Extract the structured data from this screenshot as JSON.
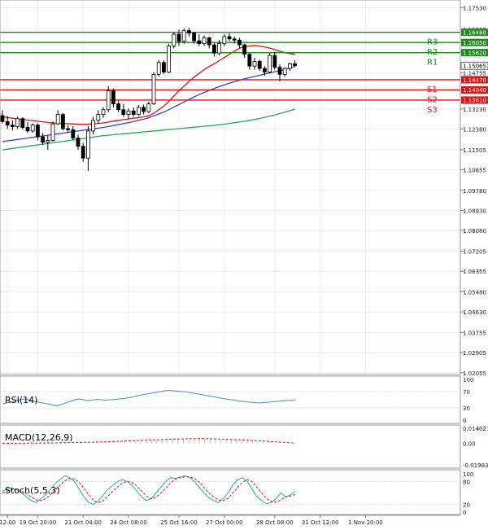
{
  "chart_data": [
    {
      "type": "candlestick",
      "price_ticks": [
        "1.17530",
        "1.16605",
        "1.15680",
        "1.14755",
        "1.13230",
        "1.12380",
        "1.11505",
        "1.10655",
        "1.09780",
        "1.08930",
        "1.08080",
        "1.07205",
        "1.06355",
        "1.05480",
        "1.04630",
        "1.03755",
        "1.02905",
        "1.02055"
      ],
      "ylim": [
        1.0198,
        1.1785
      ],
      "current_price": "1.15065",
      "candles": [
        [
          1.1295,
          1.1318,
          1.1262,
          1.127
        ],
        [
          1.127,
          1.1292,
          1.124,
          1.1255
        ],
        [
          1.1255,
          1.1275,
          1.1232,
          1.1248
        ],
        [
          1.1248,
          1.129,
          1.124,
          1.1282
        ],
        [
          1.1282,
          1.1288,
          1.1236,
          1.1245
        ],
        [
          1.1245,
          1.1268,
          1.1222,
          1.123
        ],
        [
          1.123,
          1.1262,
          1.1222,
          1.1255
        ],
        [
          1.1255,
          1.1262,
          1.119,
          1.1205
        ],
        [
          1.1205,
          1.1222,
          1.1172,
          1.1182
        ],
        [
          1.1182,
          1.121,
          1.115,
          1.119
        ],
        [
          1.119,
          1.127,
          1.1185,
          1.126
        ],
        [
          1.126,
          1.1318,
          1.1255,
          1.13
        ],
        [
          1.13,
          1.1305,
          1.1232,
          1.124
        ],
        [
          1.124,
          1.1255,
          1.1222,
          1.1235
        ],
        [
          1.1235,
          1.125,
          1.119,
          1.12
        ],
        [
          1.12,
          1.1215,
          1.115,
          1.1165
        ],
        [
          1.1165,
          1.118,
          1.11,
          1.1115
        ],
        [
          1.1115,
          1.125,
          1.106,
          1.123
        ],
        [
          1.123,
          1.129,
          1.1215,
          1.1275
        ],
        [
          1.1275,
          1.1318,
          1.1262,
          1.13
        ],
        [
          1.13,
          1.133,
          1.1285,
          1.132
        ],
        [
          1.132,
          1.142,
          1.131,
          1.14
        ],
        [
          1.14,
          1.141,
          1.133,
          1.1345
        ],
        [
          1.1345,
          1.136,
          1.131,
          1.132
        ],
        [
          1.132,
          1.1345,
          1.129,
          1.13
        ],
        [
          1.13,
          1.1325,
          1.1282,
          1.1315
        ],
        [
          1.1315,
          1.133,
          1.129,
          1.13
        ],
        [
          1.13,
          1.134,
          1.1295,
          1.133
        ],
        [
          1.133,
          1.1342,
          1.13,
          1.1312
        ],
        [
          1.1312,
          1.1355,
          1.1305,
          1.1345
        ],
        [
          1.1345,
          1.148,
          1.134,
          1.147
        ],
        [
          1.147,
          1.153,
          1.146,
          1.152
        ],
        [
          1.152,
          1.153,
          1.147,
          1.148
        ],
        [
          1.148,
          1.16,
          1.1475,
          1.159
        ],
        [
          1.159,
          1.165,
          1.158,
          1.164
        ],
        [
          1.164,
          1.166,
          1.159,
          1.161
        ],
        [
          1.161,
          1.1665,
          1.16,
          1.1655
        ],
        [
          1.1655,
          1.1668,
          1.163,
          1.1645
        ],
        [
          1.1645,
          1.165,
          1.16,
          1.1612
        ],
        [
          1.1612,
          1.164,
          1.159,
          1.16
        ],
        [
          1.16,
          1.1635,
          1.159,
          1.1625
        ],
        [
          1.1625,
          1.163,
          1.158,
          1.1595
        ],
        [
          1.1595,
          1.1605,
          1.1545,
          1.156
        ],
        [
          1.156,
          1.1615,
          1.155,
          1.16
        ],
        [
          1.16,
          1.164,
          1.159,
          1.163
        ],
        [
          1.163,
          1.1645,
          1.161,
          1.162
        ],
        [
          1.162,
          1.163,
          1.16,
          1.1615
        ],
        [
          1.1615,
          1.1625,
          1.158,
          1.1595
        ],
        [
          1.1595,
          1.16,
          1.154,
          1.1555
        ],
        [
          1.1555,
          1.156,
          1.149,
          1.1505
        ],
        [
          1.1505,
          1.154,
          1.149,
          1.1525
        ],
        [
          1.1525,
          1.1532,
          1.1485,
          1.1495
        ],
        [
          1.1495,
          1.1505,
          1.1465,
          1.148
        ],
        [
          1.148,
          1.156,
          1.1475,
          1.155
        ],
        [
          1.155,
          1.1565,
          1.149,
          1.15
        ],
        [
          1.15,
          1.1512,
          1.144,
          1.147
        ],
        [
          1.147,
          1.15,
          1.146,
          1.1495
        ],
        [
          1.1495,
          1.152,
          1.1485,
          1.1515
        ],
        [
          1.1515,
          1.153,
          1.15,
          1.1507
        ]
      ],
      "moving_averages": [
        {
          "color": "#dd1111",
          "values": [
            1.129,
            1.1287,
            1.1284,
            1.1281,
            1.1279,
            1.1276,
            1.1274,
            1.1271,
            1.1269,
            1.1266,
            1.1264,
            1.1263,
            1.1262,
            1.1261,
            1.126,
            1.1259,
            1.1258,
            1.1259,
            1.126,
            1.1262,
            1.1264,
            1.1268,
            1.1272,
            1.1275,
            1.1278,
            1.1281,
            1.1284,
            1.1287,
            1.129,
            1.1294,
            1.1305,
            1.132,
            1.1335,
            1.1355,
            1.1378,
            1.14,
            1.142,
            1.144,
            1.1458,
            1.1474,
            1.149,
            1.1503,
            1.1515,
            1.1528,
            1.1541,
            1.1555,
            1.1568,
            1.158,
            1.1587,
            1.159,
            1.1592,
            1.159,
            1.1586,
            1.1581,
            1.1575,
            1.1568,
            1.1562,
            1.1558,
            1.1555
          ]
        },
        {
          "color": "#3344cc",
          "values": [
            1.1185,
            1.1188,
            1.1191,
            1.1194,
            1.1197,
            1.12,
            1.1203,
            1.1206,
            1.1209,
            1.1212,
            1.1215,
            1.1218,
            1.1221,
            1.1224,
            1.1227,
            1.123,
            1.1233,
            1.1236,
            1.1239,
            1.1242,
            1.1245,
            1.1249,
            1.1253,
            1.1257,
            1.1261,
            1.1265,
            1.127,
            1.1275,
            1.128,
            1.1286,
            1.1294,
            1.1302,
            1.131,
            1.132,
            1.1331,
            1.1342,
            1.1353,
            1.1364,
            1.1374,
            1.1384,
            1.1393,
            1.1402,
            1.141,
            1.1418,
            1.1425,
            1.1432,
            1.1439,
            1.1445,
            1.1451,
            1.1456,
            1.1461,
            1.1466,
            1.1471,
            1.1476,
            1.1481,
            1.1486,
            1.1491,
            1.1497,
            1.1503
          ]
        },
        {
          "color": "#22aa55",
          "values": [
            1.115,
            1.1153,
            1.1156,
            1.1159,
            1.1162,
            1.1165,
            1.1168,
            1.1171,
            1.1174,
            1.1177,
            1.118,
            1.1183,
            1.1186,
            1.1189,
            1.1192,
            1.1195,
            1.1198,
            1.1201,
            1.1204,
            1.1207,
            1.121,
            1.1212,
            1.1214,
            1.1216,
            1.1218,
            1.122,
            1.1222,
            1.1224,
            1.1226,
            1.1228,
            1.123,
            1.1232,
            1.1234,
            1.1236,
            1.1238,
            1.124,
            1.1242,
            1.1244,
            1.1246,
            1.1248,
            1.125,
            1.1252,
            1.1254,
            1.1256,
            1.1259,
            1.1262,
            1.1265,
            1.1268,
            1.1271,
            1.1275,
            1.1279,
            1.1283,
            1.1288,
            1.1293,
            1.1298,
            1.1304,
            1.131,
            1.1316,
            1.1322
          ]
        }
      ],
      "levels": [
        {
          "label": "R3",
          "value": 1.1648,
          "text": "1.16480",
          "color": "#1e8a1e"
        },
        {
          "label": "R2",
          "value": 1.1605,
          "text": "1.16050",
          "color": "#1e8a1e"
        },
        {
          "label": "R1",
          "value": 1.1562,
          "text": "1.15620",
          "color": "#1e8a1e"
        },
        {
          "label": "S1",
          "value": 1.1447,
          "text": "1.14470",
          "color": "#e01010"
        },
        {
          "label": "S2",
          "value": 1.1404,
          "text": "1.14040",
          "color": "#e01010"
        },
        {
          "label": "S3",
          "value": 1.1361,
          "text": "1.13610",
          "color": "#e01010"
        }
      ]
    },
    {
      "type": "line",
      "name": "RSI(14)",
      "ticks": [
        "100",
        "70",
        "30",
        "0"
      ],
      "ylim": [
        0,
        100
      ],
      "values": [
        40,
        42,
        45,
        48,
        50,
        52,
        49,
        46,
        44,
        42,
        40,
        38,
        35,
        38,
        42,
        46,
        50,
        52,
        50,
        48,
        49,
        51,
        50,
        49,
        50,
        51,
        52,
        53,
        55,
        57,
        60,
        62,
        64,
        66,
        68,
        70,
        72,
        73,
        72,
        71,
        70,
        69,
        67,
        65,
        63,
        61,
        59,
        57,
        55,
        53,
        51,
        50,
        48,
        46,
        45,
        44,
        43,
        42,
        43,
        44,
        45,
        46,
        47,
        48,
        49,
        50
      ]
    },
    {
      "type": "histogram",
      "name": "MACD(12,26,9)",
      "ticks": [
        "0.014021",
        "0.00",
        "-0.019835"
      ],
      "ylim": [
        -0.019835,
        0.014021
      ],
      "bars": [
        0.0001,
        0.0001,
        0.0002,
        0.0002,
        0.0003,
        0.0003,
        0.0004,
        0.0004,
        0.0005,
        0.0005,
        0.0006,
        0.0007,
        0.0008,
        0.0009,
        0.001,
        0.0011,
        0.0012,
        0.0013,
        0.0014,
        0.0016,
        0.0018,
        0.002,
        0.0022,
        0.0024,
        0.0026,
        0.0028,
        0.003,
        0.0032,
        0.0034,
        0.0036,
        0.0038,
        0.004,
        0.0042,
        0.0044,
        0.0045,
        0.0046,
        0.0046,
        0.0045,
        0.0044,
        0.0042,
        0.004,
        0.0038,
        0.0035,
        0.0032,
        0.0029,
        0.0026,
        0.0023,
        0.002,
        0.0017,
        0.0014,
        0.0011,
        0.0008,
        0.0005,
        0.0002,
        -0.0001,
        -0.0004
      ],
      "signal": [
        0.0,
        0.0001,
        0.0001,
        0.0002,
        0.0002,
        0.0003,
        0.0003,
        0.0004,
        0.0004,
        0.0005,
        0.0005,
        0.0006,
        0.0007,
        0.0008,
        0.0009,
        0.001,
        0.0011,
        0.0012,
        0.0013,
        0.0014,
        0.0016,
        0.0018,
        0.002,
        0.0022,
        0.0024,
        0.0026,
        0.0028,
        0.003,
        0.0032,
        0.0034,
        0.0036,
        0.0038,
        0.004,
        0.0041,
        0.0042,
        0.0043,
        0.0044,
        0.0044,
        0.0044,
        0.0043,
        0.0042,
        0.004,
        0.0038,
        0.0036,
        0.0034,
        0.0032,
        0.003,
        0.0027,
        0.0024,
        0.0021,
        0.0018,
        0.0015,
        0.0012,
        0.0009,
        0.0006,
        0.0003
      ]
    },
    {
      "type": "line",
      "name": "Stoch(5,5,3)",
      "ticks": [
        "100",
        "80",
        "20",
        "0"
      ],
      "ylim": [
        0,
        100
      ],
      "main": [
        55,
        60,
        62,
        58,
        50,
        40,
        30,
        25,
        35,
        45,
        60,
        75,
        85,
        95,
        90,
        80,
        60,
        40,
        25,
        20,
        30,
        45,
        60,
        70,
        80,
        85,
        80,
        70,
        55,
        40,
        30,
        35,
        50,
        65,
        80,
        90,
        88,
        92,
        95,
        90,
        80,
        65,
        50,
        38,
        30,
        25,
        35,
        50,
        70,
        85,
        90,
        80,
        60,
        40,
        30,
        22,
        25,
        35,
        50,
        40,
        45,
        55
      ],
      "signal": [
        50,
        55,
        58,
        60,
        56,
        48,
        40,
        32,
        30,
        35,
        45,
        58,
        70,
        82,
        88,
        87,
        78,
        62,
        45,
        30,
        25,
        30,
        42,
        55,
        66,
        76,
        80,
        78,
        68,
        55,
        42,
        35,
        38,
        50,
        62,
        76,
        86,
        90,
        92,
        92,
        88,
        78,
        64,
        50,
        40,
        32,
        30,
        36,
        50,
        65,
        78,
        85,
        80,
        65,
        50,
        35,
        28,
        26,
        32,
        40,
        42,
        46
      ]
    },
    {
      "type": "axis",
      "x_ticks": [
        {
          "label": "12:00",
          "index": 1
        },
        {
          "label": "19 Oct 20:00",
          "index": 7
        },
        {
          "label": "21 Oct 04:00",
          "index": 16
        },
        {
          "label": "24 Oct 08:00",
          "index": 25
        },
        {
          "label": "25 Oct 16:00",
          "index": 35
        },
        {
          "label": "27 Oct 00:00",
          "index": 44
        },
        {
          "label": "28 Oct 08:00",
          "index": 54
        },
        {
          "label": "31 Oct 12:00",
          "index": 63
        },
        {
          "label": "1 Nov 20:00",
          "index": 72
        }
      ]
    }
  ]
}
